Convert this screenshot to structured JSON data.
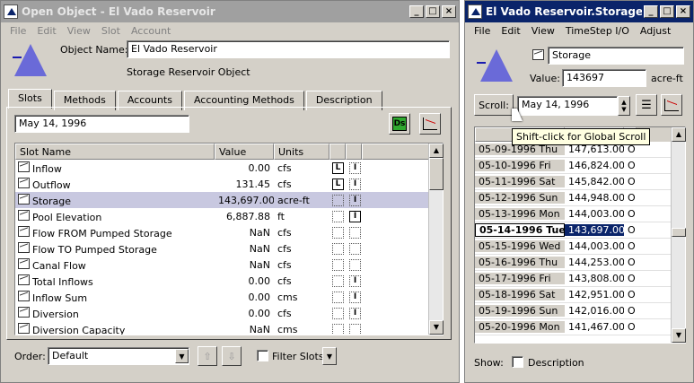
{
  "left": {
    "title": "Open Object - El Vado Reservoir",
    "menu": [
      "File",
      "Edit",
      "View",
      "Slot",
      "Account"
    ],
    "object_name_label": "Object Name:",
    "object_name": "El Vado Reservoir",
    "object_type": "Storage Reservoir Object",
    "tabs": [
      "Slots",
      "Methods",
      "Accounts",
      "Accounting Methods",
      "Description"
    ],
    "date": "May 14, 1996",
    "columns": {
      "name": "Slot Name",
      "value": "Value",
      "units": "Units"
    },
    "rows": [
      {
        "name": "Inflow",
        "value": "0.00",
        "units": "cfs",
        "f1": "L",
        "f2": "I"
      },
      {
        "name": "Outflow",
        "value": "131.45",
        "units": "cfs",
        "f1": "L",
        "f2": "I"
      },
      {
        "name": "Storage",
        "value": "143,697.00",
        "units": "acre-ft",
        "f1": "",
        "f2": "I"
      },
      {
        "name": "Pool Elevation",
        "value": "6,887.88",
        "units": "ft",
        "f1": "",
        "f2": "I"
      },
      {
        "name": "Flow FROM Pumped Storage",
        "value": "NaN",
        "units": "cfs",
        "f1": "",
        "f2": ""
      },
      {
        "name": "Flow TO Pumped Storage",
        "value": "NaN",
        "units": "cfs",
        "f1": "",
        "f2": ""
      },
      {
        "name": "Canal Flow",
        "value": "NaN",
        "units": "cfs",
        "f1": "",
        "f2": ""
      },
      {
        "name": "Total Inflows",
        "value": "0.00",
        "units": "cfs",
        "f1": "",
        "f2": "I"
      },
      {
        "name": "Inflow Sum",
        "value": "0.00",
        "units": "cms",
        "f1": "",
        "f2": "I"
      },
      {
        "name": "Diversion",
        "value": "0.00",
        "units": "cfs",
        "f1": "",
        "f2": "I"
      },
      {
        "name": "Diversion Capacity",
        "value": "NaN",
        "units": "cms",
        "f1": "",
        "f2": ""
      }
    ],
    "order_label": "Order:",
    "order_value": "Default",
    "filter_label": "Filter Slots"
  },
  "right": {
    "title": "El Vado Reservoir.Storage",
    "menu": [
      "File",
      "Edit",
      "View",
      "TimeStep I/O",
      "Adjust"
    ],
    "slot_name": "Storage",
    "value_label": "Value:",
    "value": "143697",
    "units": "acre-ft",
    "scroll_label": "Scroll:",
    "date": "May 14, 1996",
    "tooltip": "Shift-click for Global Scroll",
    "rows": [
      {
        "date": "05-09-1996 Thu",
        "value": "147,613.00",
        "flag": "O"
      },
      {
        "date": "05-10-1996 Fri",
        "value": "146,824.00",
        "flag": "O"
      },
      {
        "date": "05-11-1996 Sat",
        "value": "145,842.00",
        "flag": "O"
      },
      {
        "date": "05-12-1996 Sun",
        "value": "144,948.00",
        "flag": "O"
      },
      {
        "date": "05-13-1996 Mon",
        "value": "144,003.00",
        "flag": "O"
      },
      {
        "date": "05-14-1996 Tue",
        "value": "143,697.00",
        "flag": "O"
      },
      {
        "date": "05-15-1996 Wed",
        "value": "144,003.00",
        "flag": "O"
      },
      {
        "date": "05-16-1996 Thu",
        "value": "144,253.00",
        "flag": "O"
      },
      {
        "date": "05-17-1996 Fri",
        "value": "143,808.00",
        "flag": "O"
      },
      {
        "date": "05-18-1996 Sat",
        "value": "142,951.00",
        "flag": "O"
      },
      {
        "date": "05-19-1996 Sun",
        "value": "142,016.00",
        "flag": "O"
      },
      {
        "date": "05-20-1996 Mon",
        "value": "141,467.00",
        "flag": "O"
      }
    ],
    "show_label": "Show:",
    "description_label": "Description"
  }
}
